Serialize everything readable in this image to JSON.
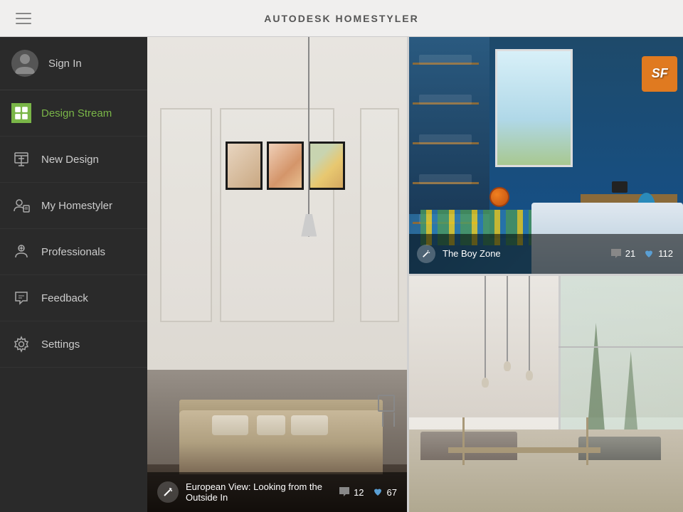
{
  "header": {
    "title": "AUTODESK",
    "title_bold": "HOMESTYLER",
    "hamburger_label": "menu"
  },
  "sidebar": {
    "sign_in": "Sign In",
    "items": [
      {
        "id": "design-stream",
        "label": "Design Stream",
        "active": true
      },
      {
        "id": "new-design",
        "label": "New Design",
        "active": false
      },
      {
        "id": "my-homestyler",
        "label": "My Homestyler",
        "active": false
      },
      {
        "id": "professionals",
        "label": "Professionals",
        "active": false
      },
      {
        "id": "feedback",
        "label": "Feedback",
        "active": false
      },
      {
        "id": "settings",
        "label": "Settings",
        "active": false
      }
    ]
  },
  "cards": {
    "main": {
      "title": "European View: Looking from the Outside In",
      "comments": "12",
      "likes": "67"
    },
    "top_right": {
      "title": "The Boy Zone",
      "comments": "21",
      "likes": "112",
      "logo_text": "SF"
    },
    "bottom_right": {
      "title": "",
      "comments": "",
      "likes": ""
    }
  },
  "icons": {
    "hamburger": "☰",
    "wand": "✦",
    "comment": "💬",
    "heart": "♥",
    "person": "👤",
    "design_stream": "▦",
    "new_design": "⊡",
    "my_homestyler": "◉",
    "professionals": "◎",
    "feedback": "↩",
    "settings": "⚙"
  },
  "colors": {
    "sidebar_bg": "#2a2a2a",
    "sidebar_active_text": "#7ab648",
    "sidebar_active_icon_bg": "#7ab648",
    "header_bg": "#f0efee",
    "overlay_bg": "rgba(0,0,0,0.55)",
    "accent_blue": "#5a9fd4"
  }
}
